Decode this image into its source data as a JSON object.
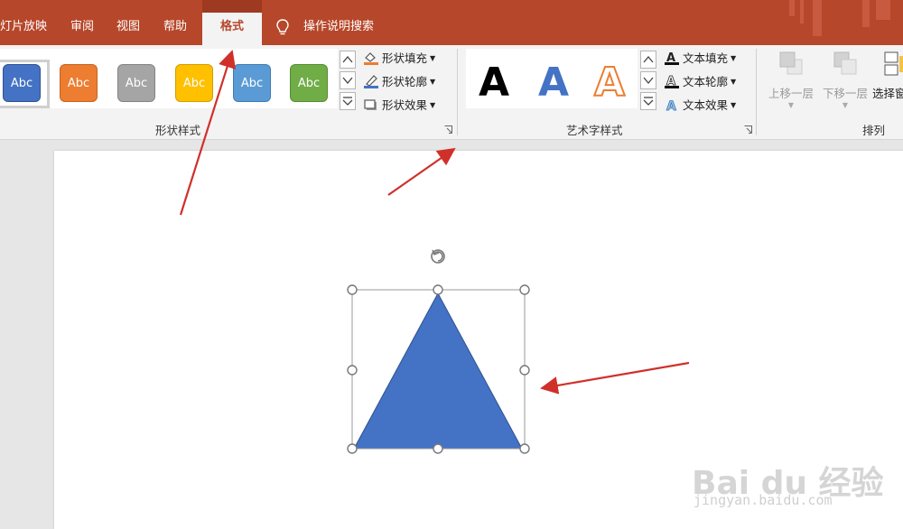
{
  "tabs": [
    {
      "label": "灯片放映"
    },
    {
      "label": "审阅"
    },
    {
      "label": "视图"
    },
    {
      "label": "帮助"
    },
    {
      "label": "格式",
      "active": true
    }
  ],
  "search_label": "操作说明搜索",
  "shape_styles": {
    "swatches": [
      {
        "label": "Abc",
        "color": "#4472c4"
      },
      {
        "label": "Abc",
        "color": "#ed7d31"
      },
      {
        "label": "Abc",
        "color": "#a5a5a5"
      },
      {
        "label": "Abc",
        "color": "#ffc000"
      },
      {
        "label": "Abc",
        "color": "#5b9bd5"
      },
      {
        "label": "Abc",
        "color": "#70ad47"
      }
    ],
    "fill_label": "形状填充",
    "outline_label": "形状轮廓",
    "effects_label": "形状效果",
    "group_label": "形状样式"
  },
  "wordart": {
    "letter": "A",
    "group_label": "艺术字样式",
    "fill_label": "文本填充",
    "outline_label": "文本轮廓",
    "effects_label": "文本效果"
  },
  "arrange": {
    "bring_forward_label": "上移一层",
    "send_backward_label": "下移一层",
    "selection_label": "选择窗",
    "group_label": "排列"
  },
  "watermark": {
    "brand": "Bai du 经验",
    "url": "jingyan.baidu.com"
  },
  "colors": {
    "accent": "#b7472a",
    "shape_fill": "#4472c4",
    "annotation_arrow": "#d0302a"
  }
}
